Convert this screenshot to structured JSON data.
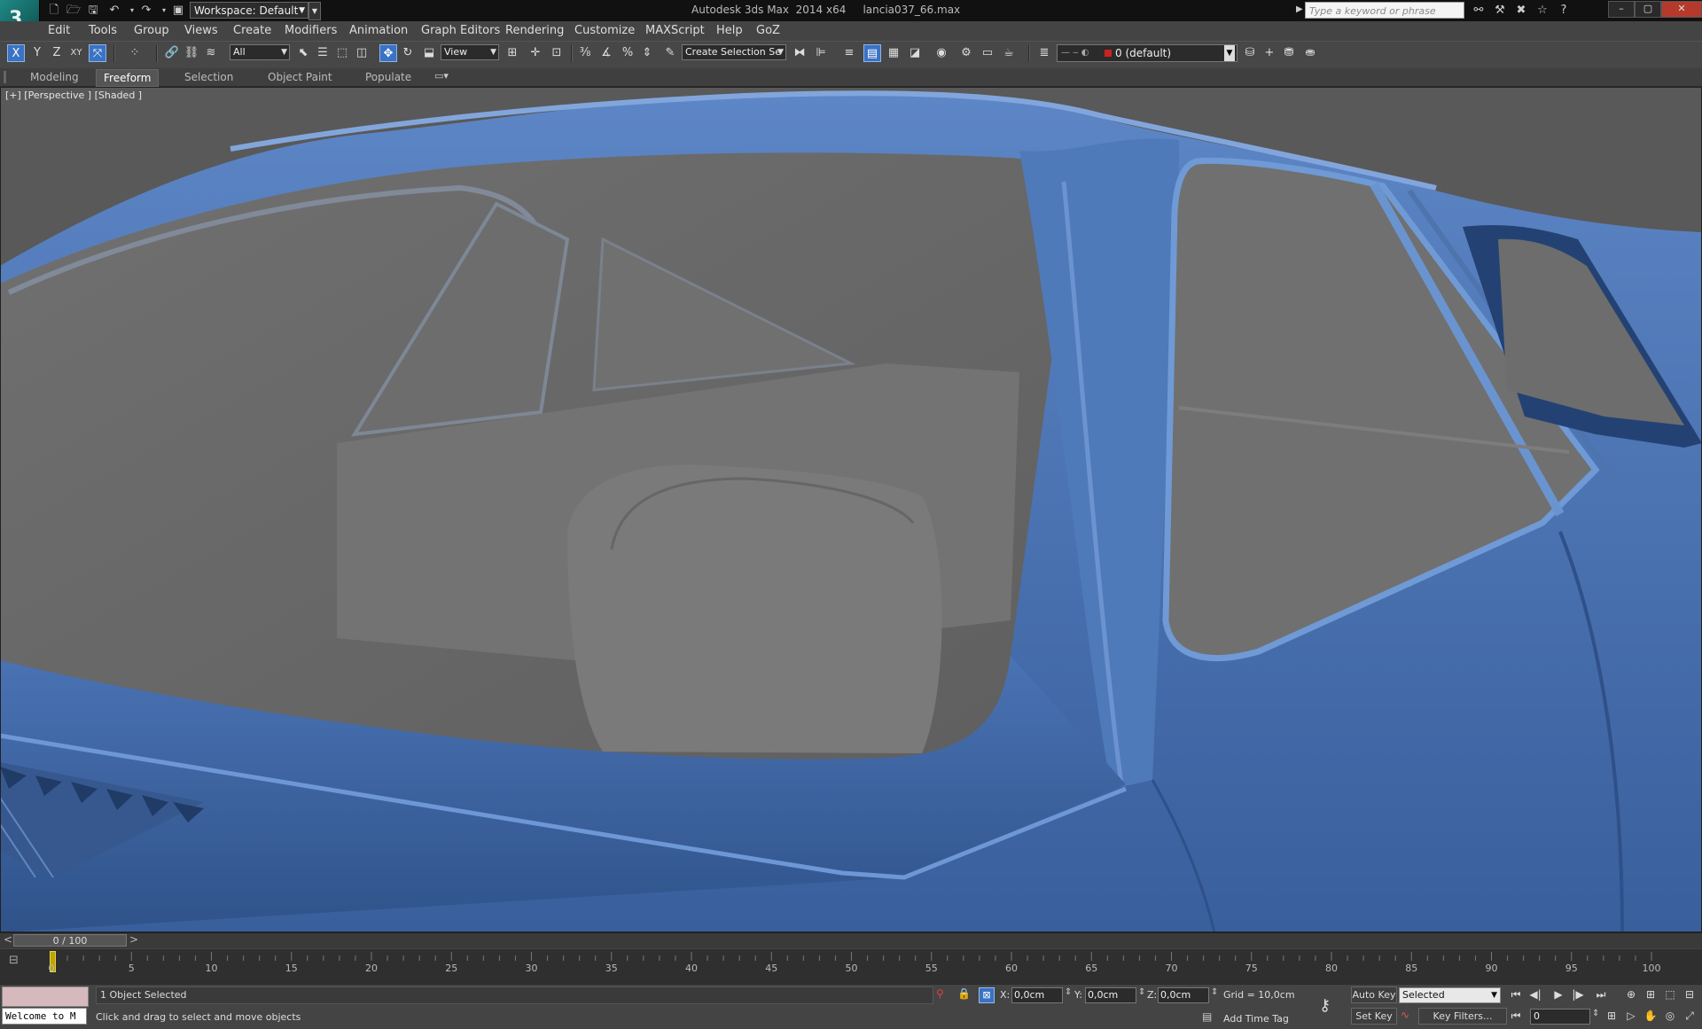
{
  "titlebar": {
    "app_logo": "3",
    "workspace": "Workspace: Default",
    "app_title": "Autodesk 3ds Max  2014 x64",
    "file_name": "lancia037_66.max",
    "search_placeholder": "Type a keyword or phrase",
    "minimize": "–",
    "maximize": "▢",
    "close": "✕"
  },
  "menu": [
    "Edit",
    "Tools",
    "Group",
    "Views",
    "Create",
    "Modifiers",
    "Animation",
    "Graph Editors",
    "Rendering",
    "Customize",
    "MAXScript",
    "Help",
    "GoZ"
  ],
  "toolbar": {
    "axis_x": "X",
    "axis_y": "Y",
    "axis_z": "Z",
    "axis_xy": "XY",
    "selection_filter": "All",
    "coord_system": "View",
    "named_selection": "Create Selection Se",
    "layer": "0 (default)"
  },
  "ribbon_tabs": [
    "Modeling",
    "Freeform",
    "Selection",
    "Object Paint",
    "Populate"
  ],
  "ribbon_selected": "Freeform",
  "viewport": {
    "label": "[+] [Perspective ] [Shaded ]",
    "colors": {
      "body": "#4a74b8",
      "glass": "#686868",
      "interior": "#737373",
      "background": "#595959"
    }
  },
  "timeline": {
    "slider": "0 / 100",
    "ticks": [
      "0",
      "5",
      "10",
      "15",
      "20",
      "25",
      "30",
      "35",
      "40",
      "45",
      "50",
      "55",
      "60",
      "65",
      "70",
      "75",
      "80",
      "85",
      "90",
      "95",
      "100"
    ]
  },
  "status": {
    "listener": "Welcome to M",
    "selection": "1 Object Selected",
    "prompt": "Click and drag to select and move objects",
    "x_label": "X:",
    "x_value": "0,0cm",
    "y_label": "Y:",
    "y_value": "0,0cm",
    "z_label": "Z:",
    "z_value": "0,0cm",
    "grid": "Grid = 10,0cm",
    "add_time_tag": "Add Time Tag",
    "auto_key": "Auto Key",
    "set_key": "Set Key",
    "key_mode": "Selected",
    "key_filters": "Key Filters...",
    "current_frame": "0"
  }
}
